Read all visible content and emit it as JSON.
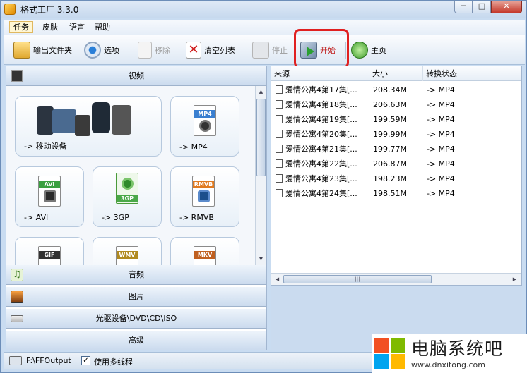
{
  "window": {
    "title": "格式工厂 3.3.0",
    "min": "─",
    "max": "□",
    "close": "✕"
  },
  "menu": [
    "任务",
    "皮肤",
    "语言",
    "帮助"
  ],
  "toolbar": {
    "output_folder": "输出文件夹",
    "options": "选项",
    "remove": "移除",
    "clear_list": "清空列表",
    "stop": "停止",
    "start": "开始",
    "home": "主页"
  },
  "sections": {
    "video": "视频",
    "audio": "音频",
    "picture": "图片",
    "rom": "光驱设备\\DVD\\CD\\ISO",
    "advanced": "高级"
  },
  "tiles": [
    {
      "label": "-> 移动设备",
      "icon": "mobile-devices-icon"
    },
    {
      "label": "-> MP4",
      "tag": "MP4",
      "color": "#3a7fd0"
    },
    {
      "label": "-> AVI",
      "tag": "AVI",
      "color": "#3aa040"
    },
    {
      "label": "-> 3GP",
      "tag": "3GP",
      "color": "#4aa848"
    },
    {
      "label": "-> RMVB",
      "tag": "RMVB",
      "color": "#e07a20"
    },
    {
      "label": "",
      "tag": "GIF",
      "color": "#333333"
    },
    {
      "label": "",
      "tag": "WMV",
      "color": "#b08a20"
    },
    {
      "label": "",
      "tag": "MKV",
      "color": "#c06020"
    }
  ],
  "table": {
    "headers": [
      "来源",
      "大小",
      "转换状态"
    ],
    "rows": [
      [
        "爱情公寓4第17集[...",
        "208.34M",
        "-> MP4"
      ],
      [
        "爱情公寓4第18集[...",
        "206.63M",
        "-> MP4"
      ],
      [
        "爱情公寓4第19集[...",
        "199.59M",
        "-> MP4"
      ],
      [
        "爱情公寓4第20集[...",
        "199.99M",
        "-> MP4"
      ],
      [
        "爱情公寓4第21集[...",
        "199.77M",
        "-> MP4"
      ],
      [
        "爱情公寓4第22集[...",
        "206.87M",
        "-> MP4"
      ],
      [
        "爱情公寓4第23集[...",
        "198.23M",
        "-> MP4"
      ],
      [
        "爱情公寓4第24集[...",
        "198.51M",
        "-> MP4"
      ]
    ]
  },
  "status": {
    "output_path": "F:\\FFOutput",
    "multithread_label": "使用多线程",
    "multithread_checked": "✓"
  },
  "watermark": {
    "text": "电脑系统吧",
    "url": "www.dnxitong.com"
  }
}
